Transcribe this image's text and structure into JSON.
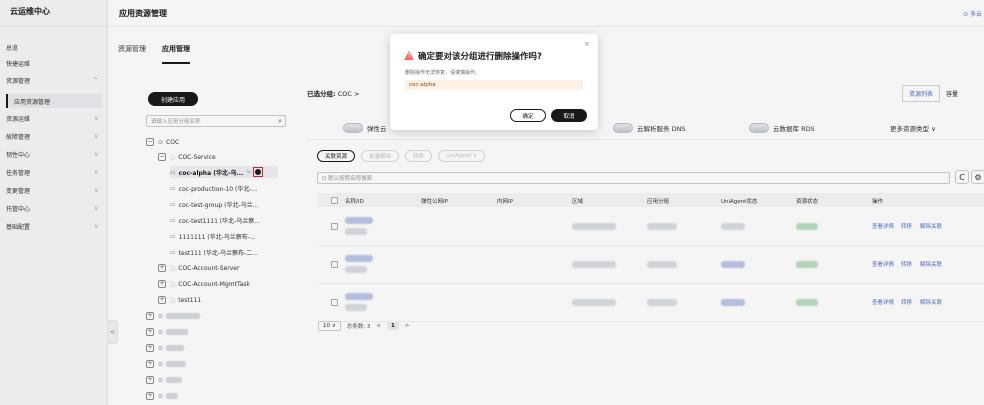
{
  "sidebar": {
    "title": "云运维中心",
    "items": [
      {
        "label": "总览",
        "chevron": false
      },
      {
        "label": "快捷运维",
        "chevron": false
      },
      {
        "label": "资源管理",
        "chevron": true,
        "chevron_char": "^"
      },
      {
        "label": "应用资源管理",
        "sub": true
      },
      {
        "label": "资源运维",
        "chevron": true,
        "chevron_char": "v"
      },
      {
        "label": "故障管理",
        "chevron": true,
        "chevron_char": "v"
      },
      {
        "label": "韧性中心",
        "chevron": true,
        "chevron_char": "v"
      },
      {
        "label": "任务管理",
        "chevron": true,
        "chevron_char": "v"
      },
      {
        "label": "变更管理",
        "chevron": true,
        "chevron_char": "v"
      },
      {
        "label": "托管中心",
        "chevron": true,
        "chevron_char": "v"
      },
      {
        "label": "基础配置",
        "chevron": true,
        "chevron_char": "v"
      }
    ],
    "collapse_glyph": "<"
  },
  "header": {
    "title": "应用资源管理",
    "right_link": "⊙ 多云"
  },
  "tabs": [
    {
      "label": "资源管理",
      "active": false
    },
    {
      "label": "应用管理",
      "active": true
    }
  ],
  "tree": {
    "create_button": "创建应用",
    "search_placeholder": "请输入应用分组名称",
    "nodes": [
      {
        "label": "COC",
        "toggle": "−",
        "glyph": "⊙"
      },
      {
        "label": "COC-Service",
        "toggle": "−",
        "glyph": "◌"
      },
      {
        "label": "coc-alpha (华北-乌...",
        "selected": true
      },
      {
        "label": "coc-production-10 (华北-..."
      },
      {
        "label": "coc-test-group (华北-乌兰..."
      },
      {
        "label": "coc-test1111 (华北-乌兰察..."
      },
      {
        "label": "1111111 (华北-乌兰察布-..."
      },
      {
        "label": "test111 (华北-乌兰察布-二..."
      },
      {
        "label": "COC-Account-Server",
        "toggle": "+",
        "glyph": "◌"
      },
      {
        "label": "COC-Account-MgmtTask",
        "toggle": "+",
        "glyph": "◌"
      },
      {
        "label": "test111",
        "toggle": "+",
        "glyph": "◌"
      }
    ],
    "blurred_toggle": "+",
    "blurred_glyph": "⊙",
    "leaf_glyph": "▭",
    "edit_glyph": "✎"
  },
  "main": {
    "crumb_label": "已选分组:",
    "crumb_value": "COC >",
    "view_toggle": {
      "resource_list": "资源列表",
      "capacity": "容量"
    },
    "resource_types": [
      {
        "label": "弹性云"
      },
      {
        "label": "云解析服务 DNS"
      },
      {
        "label": "云数据库 RDS"
      },
      {
        "label": "更多资源类型 ∨"
      }
    ],
    "actions": [
      {
        "label": "关联资源",
        "disabled": false
      },
      {
        "label": "批量解除",
        "disabled": true
      },
      {
        "label": "转移",
        "disabled": true
      },
      {
        "label": "UniAgent ∨",
        "disabled": true
      }
    ],
    "filter_placeholder": "Q 默认按照名称搜索",
    "refresh_icon": "C",
    "settings_icon": "⚙",
    "columns": [
      "名称/ID",
      "弹性公网IP",
      "内网IP",
      "区域",
      "应用分组",
      "UniAgent状态",
      "资源状态",
      "操作"
    ],
    "row_ops": [
      "查看详情",
      "转移",
      "解除关联"
    ],
    "row_count": 3,
    "pager": {
      "page_size": "10 ∨",
      "total": "总条数: 3",
      "prev": "<",
      "current": "1",
      "next": ">"
    }
  },
  "dialog": {
    "title": "确定要对该分组进行删除操作吗?",
    "description": "删除操作无法恢复，请谨慎操作。",
    "group_name": "coc-alpha",
    "ok": "确定",
    "cancel": "取消",
    "close": "×",
    "warn_mark": "!"
  },
  "colors": {
    "accent": "#191919",
    "link": "#526ecc",
    "warning": "#f66f6a",
    "delete_highlight": "#e02424"
  }
}
